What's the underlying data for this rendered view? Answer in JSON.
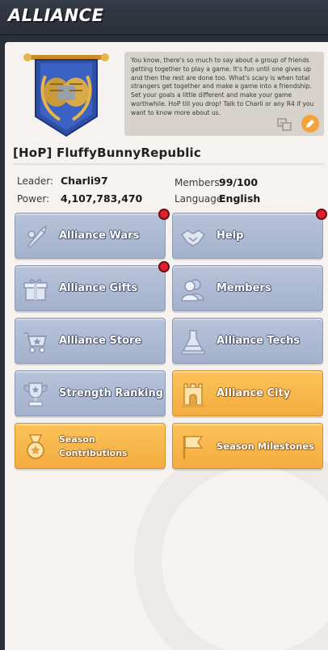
{
  "header": {
    "title": "ALLIANCE"
  },
  "alliance": {
    "name": "[HoP] FluffyBunnyRepublic",
    "description": "You know, there's so much to say about a group of friends getting together to play a game. It's fun until one gives up and then the rest are done too. What's scary is when total strangers get together and make a game into a friendship. Set your goals a little different and make your game worthwhile. HoP till you drop! Talk to Charli or any R4 if you want to know more about us.",
    "leader_label": "Leader:",
    "leader": "Charli97",
    "power_label": "Power:",
    "power": "4,107,783,470",
    "members_label": "Members:",
    "members": "99/100",
    "language_label": "Language:",
    "language": "English"
  },
  "menu": [
    {
      "label": "Alliance Wars",
      "icon": "rocket-icon",
      "style": "blue",
      "notification": true
    },
    {
      "label": "Help",
      "icon": "handshake-icon",
      "style": "blue",
      "notification": true
    },
    {
      "label": "Alliance Gifts",
      "icon": "gift-icon",
      "style": "blue",
      "notification": true
    },
    {
      "label": "Members",
      "icon": "members-icon",
      "style": "blue",
      "notification": false
    },
    {
      "label": "Alliance Store",
      "icon": "cart-icon",
      "style": "blue",
      "notification": false
    },
    {
      "label": "Alliance Techs",
      "icon": "flask-icon",
      "style": "blue",
      "notification": false
    },
    {
      "label": "Strength Ranking",
      "icon": "trophy-icon",
      "style": "blue",
      "notification": false
    },
    {
      "label": "Alliance City",
      "icon": "city-icon",
      "style": "gold",
      "notification": false
    },
    {
      "label": "Season Contributions",
      "icon": "medal-icon",
      "style": "gold",
      "notification": false
    },
    {
      "label": "Season Milestones",
      "icon": "flag-icon",
      "style": "gold",
      "notification": false
    }
  ],
  "colors": {
    "tile_blue": "#aab6cf",
    "tile_gold": "#f7b54a",
    "notification": "#e0202c",
    "edit_button": "#f2a33a"
  }
}
